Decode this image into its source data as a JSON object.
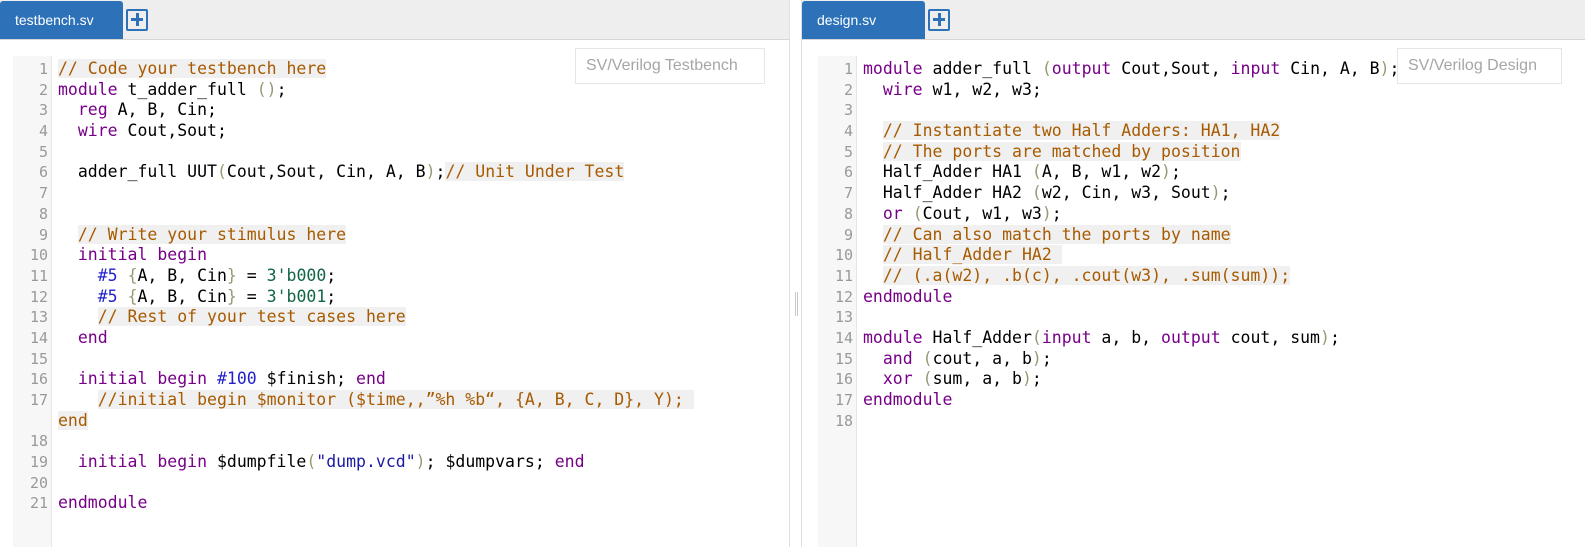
{
  "left_pane": {
    "tab_label": "testbench.sv",
    "badge": "SV/Verilog Testbench"
  },
  "right_pane": {
    "tab_label": "design.sv",
    "badge": "SV/Verilog Design"
  },
  "testbench_code": [
    {
      "n": "1",
      "parts": [
        [
          "cm",
          "// Code your testbench here"
        ]
      ]
    },
    {
      "n": "2",
      "parts": [
        [
          "kw",
          "module"
        ],
        [
          "",
          " t_adder_full "
        ],
        [
          "br",
          "()"
        ],
        [
          "",
          ";"
        ]
      ]
    },
    {
      "n": "3",
      "parts": [
        [
          "",
          "  "
        ],
        [
          "kw",
          "reg"
        ],
        [
          "",
          " A, B, Cin;"
        ]
      ]
    },
    {
      "n": "4",
      "parts": [
        [
          "",
          "  "
        ],
        [
          "kw",
          "wire"
        ],
        [
          "",
          " Cout,Sout;"
        ]
      ]
    },
    {
      "n": "5",
      "parts": []
    },
    {
      "n": "6",
      "parts": [
        [
          "",
          "  adder_full UUT"
        ],
        [
          "br",
          "("
        ],
        [
          "",
          "Cout,Sout, Cin, A, B"
        ],
        [
          "br",
          ")"
        ],
        [
          "",
          ";"
        ],
        [
          "cm",
          "// Unit Under Test"
        ]
      ]
    },
    {
      "n": "7",
      "parts": []
    },
    {
      "n": "8",
      "parts": []
    },
    {
      "n": "9",
      "parts": [
        [
          "",
          "  "
        ],
        [
          "cm",
          "// Write your stimulus here"
        ]
      ]
    },
    {
      "n": "10",
      "parts": [
        [
          "",
          "  "
        ],
        [
          "kw",
          "initial begin"
        ]
      ]
    },
    {
      "n": "11",
      "parts": [
        [
          "",
          "    "
        ],
        [
          "at",
          "#5"
        ],
        [
          "",
          " "
        ],
        [
          "br",
          "{"
        ],
        [
          "",
          "A, B, Cin"
        ],
        [
          "br",
          "}"
        ],
        [
          "",
          " = "
        ],
        [
          "num",
          "3'b000"
        ],
        [
          "",
          ";"
        ]
      ]
    },
    {
      "n": "12",
      "parts": [
        [
          "",
          "    "
        ],
        [
          "at",
          "#5"
        ],
        [
          "",
          " "
        ],
        [
          "br",
          "{"
        ],
        [
          "",
          "A, B, Cin"
        ],
        [
          "br",
          "}"
        ],
        [
          "",
          " = "
        ],
        [
          "num",
          "3'b001"
        ],
        [
          "",
          ";"
        ]
      ]
    },
    {
      "n": "13",
      "parts": [
        [
          "",
          "    "
        ],
        [
          "cm",
          "// Rest of your test cases here"
        ]
      ]
    },
    {
      "n": "14",
      "parts": [
        [
          "",
          "  "
        ],
        [
          "kw",
          "end"
        ]
      ]
    },
    {
      "n": "15",
      "parts": []
    },
    {
      "n": "16",
      "parts": [
        [
          "",
          "  "
        ],
        [
          "kw",
          "initial begin"
        ],
        [
          "",
          " "
        ],
        [
          "at",
          "#100"
        ],
        [
          "",
          " $finish; "
        ],
        [
          "kw",
          "end"
        ]
      ]
    },
    {
      "n": "17",
      "wrap": true,
      "parts": [
        [
          "",
          "    "
        ],
        [
          "cm",
          "//initial begin $monitor ($time,,”%h %b“, {A, B, C, D}, Y); \nend"
        ]
      ]
    },
    {
      "n": "18",
      "parts": []
    },
    {
      "n": "19",
      "parts": [
        [
          "",
          "  "
        ],
        [
          "kw",
          "initial begin"
        ],
        [
          "",
          " $dumpfile"
        ],
        [
          "br",
          "("
        ],
        [
          "str",
          "\"dump.vcd\""
        ],
        [
          "br",
          ")"
        ],
        [
          "",
          "; $dumpvars; "
        ],
        [
          "kw",
          "end"
        ]
      ]
    },
    {
      "n": "20",
      "parts": []
    },
    {
      "n": "21",
      "parts": [
        [
          "kw",
          "endmodule"
        ]
      ]
    }
  ],
  "design_code": [
    {
      "n": "1",
      "parts": [
        [
          "kw",
          "module"
        ],
        [
          "",
          " adder_full "
        ],
        [
          "br",
          "("
        ],
        [
          "kw",
          "output"
        ],
        [
          "",
          " Cout,Sout, "
        ],
        [
          "kw",
          "input"
        ],
        [
          "",
          " Cin, A, B"
        ],
        [
          "br",
          ")"
        ],
        [
          "",
          ";"
        ]
      ]
    },
    {
      "n": "2",
      "parts": [
        [
          "",
          "  "
        ],
        [
          "kw",
          "wire"
        ],
        [
          "",
          " w1, w2, w3;"
        ]
      ]
    },
    {
      "n": "3",
      "parts": []
    },
    {
      "n": "4",
      "parts": [
        [
          "",
          "  "
        ],
        [
          "cm",
          "// Instantiate two Half Adders: HA1, HA2"
        ]
      ]
    },
    {
      "n": "5",
      "parts": [
        [
          "",
          "  "
        ],
        [
          "cm",
          "// The ports are matched by position"
        ]
      ]
    },
    {
      "n": "6",
      "parts": [
        [
          "",
          "  Half_Adder HA1 "
        ],
        [
          "br",
          "("
        ],
        [
          "",
          "A, B, w1, w2"
        ],
        [
          "br",
          ")"
        ],
        [
          "",
          ";"
        ]
      ]
    },
    {
      "n": "7",
      "parts": [
        [
          "",
          "  Half_Adder HA2 "
        ],
        [
          "br",
          "("
        ],
        [
          "",
          "w2, Cin, w3, Sout"
        ],
        [
          "br",
          ")"
        ],
        [
          "",
          ";"
        ]
      ]
    },
    {
      "n": "8",
      "parts": [
        [
          "",
          "  "
        ],
        [
          "kw",
          "or"
        ],
        [
          "",
          " "
        ],
        [
          "br",
          "("
        ],
        [
          "",
          "Cout, w1, w3"
        ],
        [
          "br",
          ")"
        ],
        [
          "",
          ";"
        ]
      ]
    },
    {
      "n": "9",
      "parts": [
        [
          "",
          "  "
        ],
        [
          "cm",
          "// Can also match the ports by name"
        ]
      ]
    },
    {
      "n": "10",
      "parts": [
        [
          "",
          "  "
        ],
        [
          "cm",
          "// Half_Adder HA2 "
        ]
      ]
    },
    {
      "n": "11",
      "parts": [
        [
          "",
          "  "
        ],
        [
          "cm",
          "// (.a(w2), .b(c), .cout(w3), .sum(sum));"
        ]
      ]
    },
    {
      "n": "12",
      "parts": [
        [
          "kw",
          "endmodule"
        ]
      ]
    },
    {
      "n": "13",
      "parts": []
    },
    {
      "n": "14",
      "parts": [
        [
          "kw",
          "module"
        ],
        [
          "",
          " Half_Adder"
        ],
        [
          "br",
          "("
        ],
        [
          "kw",
          "input"
        ],
        [
          "",
          " a, b, "
        ],
        [
          "kw",
          "output"
        ],
        [
          "",
          " cout, sum"
        ],
        [
          "br",
          ")"
        ],
        [
          "",
          ";"
        ]
      ]
    },
    {
      "n": "15",
      "parts": [
        [
          "",
          "  "
        ],
        [
          "kw",
          "and"
        ],
        [
          "",
          " "
        ],
        [
          "br",
          "("
        ],
        [
          "",
          "cout, a, b"
        ],
        [
          "br",
          ")"
        ],
        [
          "",
          ";"
        ]
      ]
    },
    {
      "n": "16",
      "parts": [
        [
          "",
          "  "
        ],
        [
          "kw",
          "xor"
        ],
        [
          "",
          " "
        ],
        [
          "br",
          "("
        ],
        [
          "",
          "sum, a, b"
        ],
        [
          "br",
          ")"
        ],
        [
          "",
          ";"
        ]
      ]
    },
    {
      "n": "17",
      "parts": [
        [
          "kw",
          "endmodule"
        ]
      ]
    },
    {
      "n": "18",
      "parts": []
    }
  ]
}
